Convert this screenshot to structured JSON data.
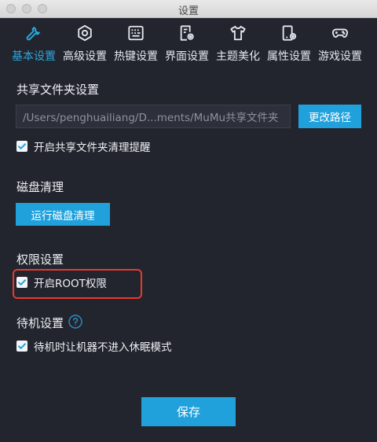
{
  "window": {
    "title": "设置"
  },
  "tabs": [
    {
      "label": "基本设置",
      "icon": "wrench-icon",
      "active": true
    },
    {
      "label": "高级设置",
      "icon": "hexagon-icon",
      "active": false
    },
    {
      "label": "热键设置",
      "icon": "keyboard-icon",
      "active": false
    },
    {
      "label": "界面设置",
      "icon": "document-gear-icon",
      "active": false
    },
    {
      "label": "主题美化",
      "icon": "tshirt-icon",
      "active": false
    },
    {
      "label": "属性设置",
      "icon": "device-gear-icon",
      "active": false
    },
    {
      "label": "游戏设置",
      "icon": "gamepad-icon",
      "active": false
    }
  ],
  "shared_folder": {
    "title": "共享文件夹设置",
    "path_value": "/Users/penghuailiang/D...ments/MuMu共享文件夹",
    "change_path_label": "更改路径",
    "cleanup_reminder_label": "开启共享文件夹清理提醒",
    "cleanup_reminder_checked": true
  },
  "disk_cleanup": {
    "title": "磁盘清理",
    "run_button_label": "运行磁盘清理"
  },
  "permissions": {
    "title": "权限设置",
    "root_label": "开启ROOT权限",
    "root_checked": true
  },
  "standby": {
    "title": "待机设置",
    "no_sleep_label": "待机时让机器不进入休眠模式",
    "no_sleep_checked": true
  },
  "footer": {
    "save_label": "保存"
  },
  "colors": {
    "accent": "#20a1dc",
    "background": "#23252e",
    "highlight": "#e8392c"
  }
}
